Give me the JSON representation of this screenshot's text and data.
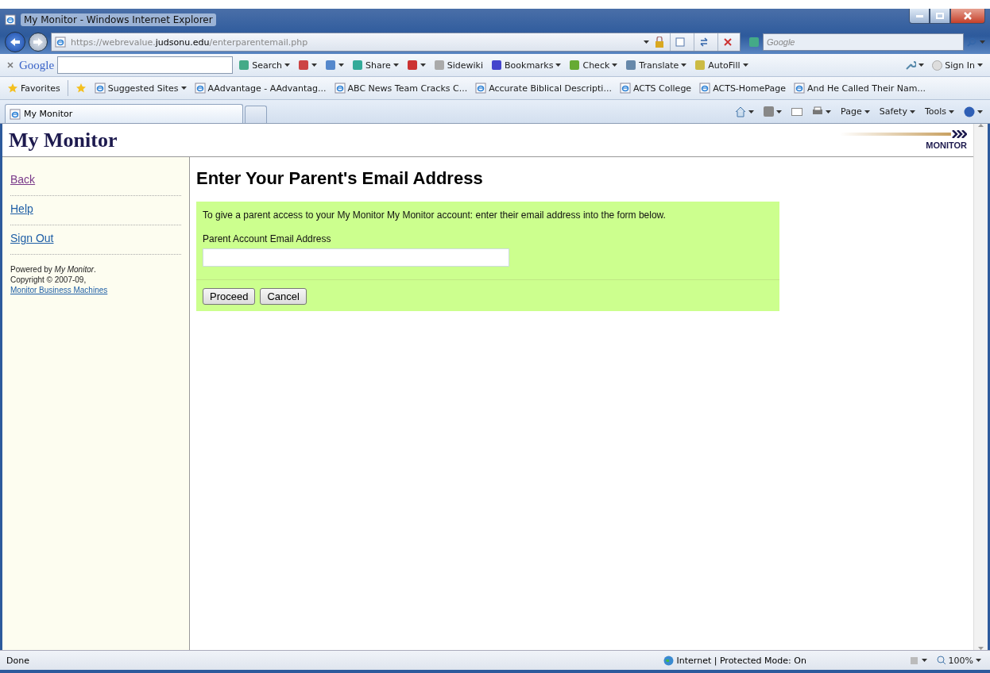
{
  "window": {
    "title": "My Monitor - Windows Internet Explorer"
  },
  "address_bar": {
    "url": "https://webrevalue.**judsonu.edu**/enterparentemail.php"
  },
  "search_box": {
    "placeholder": "Google"
  },
  "google_toolbar": {
    "brand": "Google",
    "items": [
      {
        "kind": "menu",
        "label": "Search"
      },
      {
        "kind": "icon"
      },
      {
        "kind": "icon"
      },
      {
        "kind": "menu",
        "label": "Share"
      },
      {
        "kind": "icon"
      },
      {
        "kind": "plain",
        "label": "Sidewiki"
      },
      {
        "kind": "menu",
        "label": "Bookmarks"
      },
      {
        "kind": "menu",
        "label": "Check"
      },
      {
        "kind": "menu",
        "label": "Translate"
      },
      {
        "kind": "menu",
        "label": "AutoFill"
      }
    ],
    "sign_in": "Sign In"
  },
  "favorites_bar": {
    "label": "Favorites",
    "items": [
      {
        "kind": "menu",
        "label": "Suggested Sites"
      },
      {
        "kind": "page",
        "label": "AAdvantage - AAdvantag..."
      },
      {
        "kind": "page",
        "label": "ABC News Team Cracks C..."
      },
      {
        "kind": "page",
        "label": "Accurate Biblical Descripti..."
      },
      {
        "kind": "page",
        "label": "ACTS College"
      },
      {
        "kind": "page",
        "label": "ACTS-HomePage"
      },
      {
        "kind": "page",
        "label": "And He Called Their Nam..."
      }
    ]
  },
  "tabs": [
    {
      "label": "My Monitor",
      "selected": true
    }
  ],
  "command_bar": [
    "Page",
    "Safety",
    "Tools"
  ],
  "page": {
    "brand": "My Monitor",
    "logo": "MONITOR",
    "sidebar": [
      {
        "label": "Back",
        "visited": true
      },
      {
        "label": "Help",
        "visited": false
      },
      {
        "label": "Sign Out",
        "visited": false
      }
    ],
    "footer": {
      "powered": "Powered by *My Monitor*.",
      "copyright": "Copyright © 2007-09,",
      "link": "Monitor Business Machines"
    },
    "heading": "Enter Your Parent's Email Address",
    "intro": "To give a parent access to your My Monitor My Monitor account: enter their email address into the form below.",
    "field_label": "Parent Account Email Address",
    "buttons": [
      "Proceed",
      "Cancel"
    ]
  },
  "status_bar": {
    "text": "Done",
    "zone": "Internet | Protected Mode: On",
    "zoom": "100%"
  }
}
